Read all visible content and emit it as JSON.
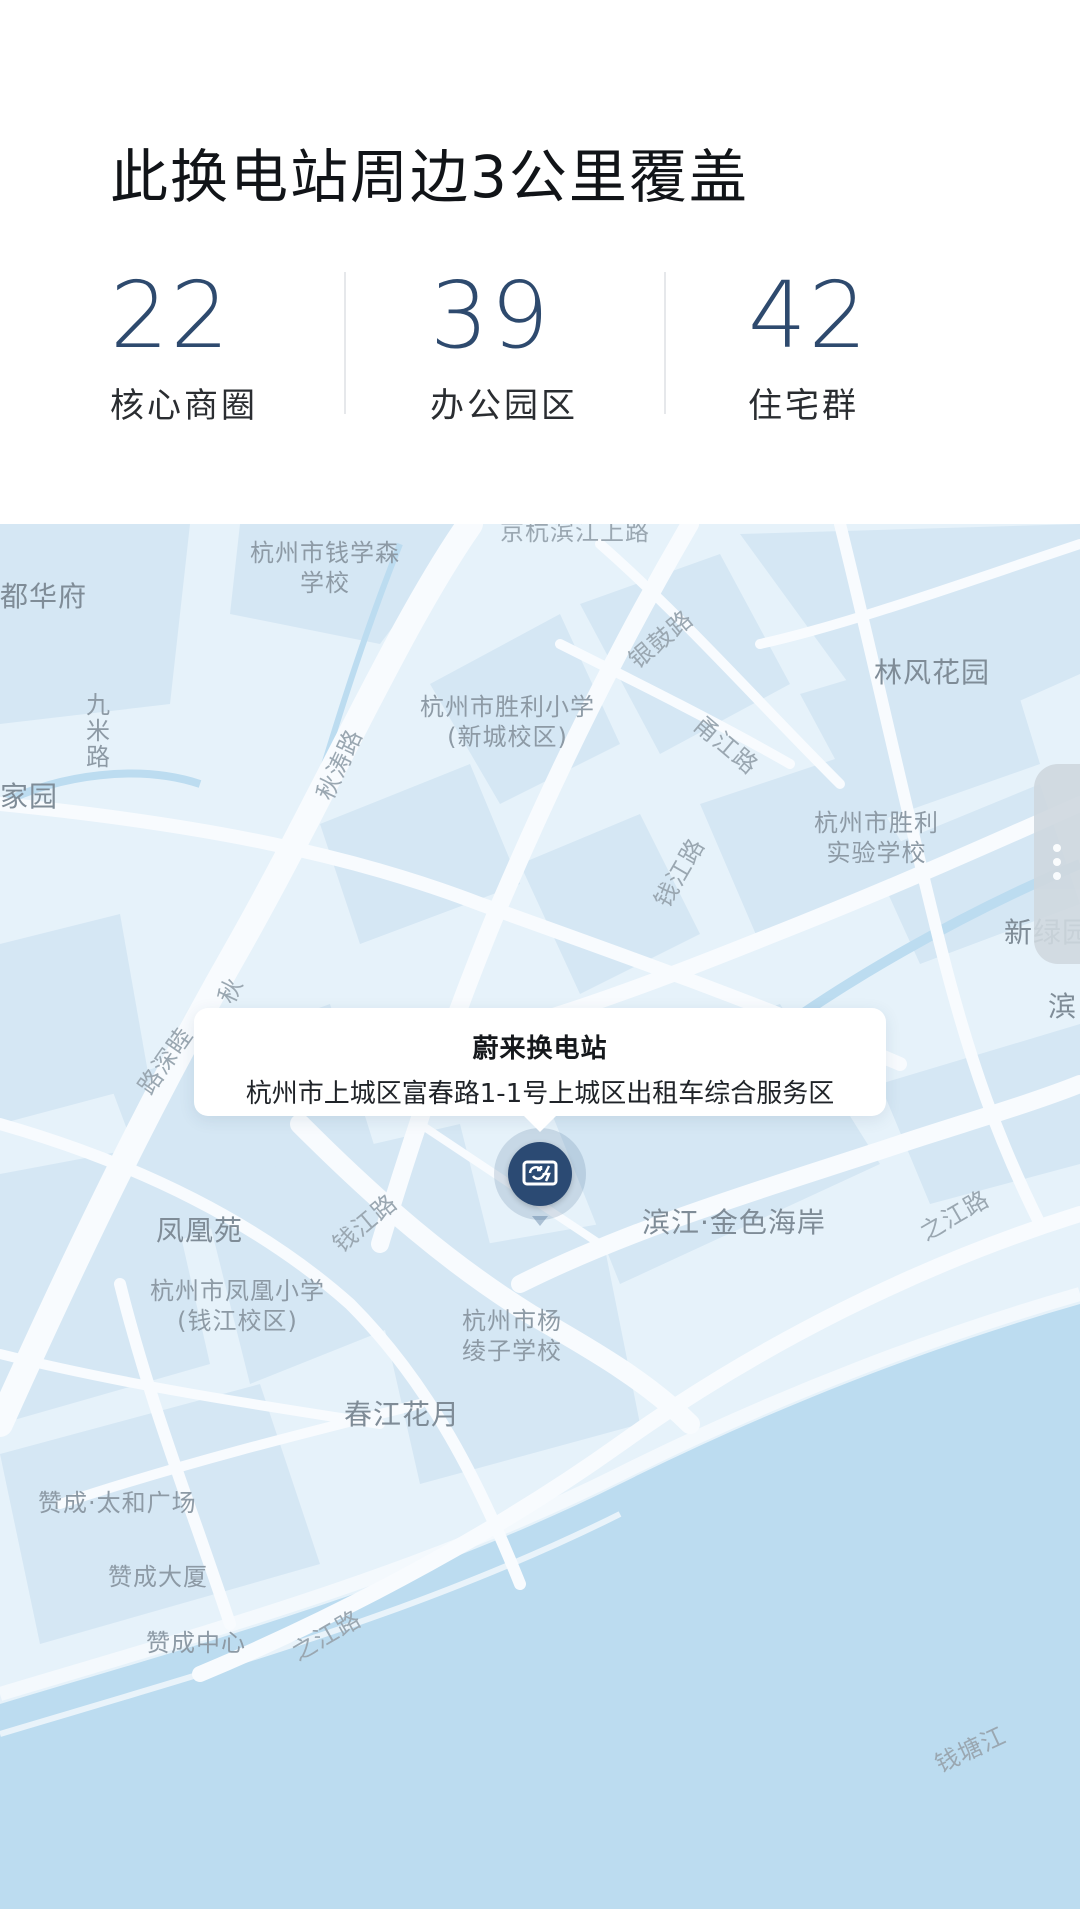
{
  "header": {
    "title": "此换电站周边3公里覆盖",
    "stats": [
      {
        "value": "22",
        "label": "核心商圈"
      },
      {
        "value": "39",
        "label": "办公园区"
      },
      {
        "value": "42",
        "label": "住宅群"
      }
    ]
  },
  "map": {
    "labels": {
      "qianxuesen": "杭州市钱学森\n学校",
      "duhuafu": "都华府",
      "jiamiroad": "九\n米\n路",
      "jiayuan": "家园",
      "shengli_xincheng": "杭州市胜利小学\n(新城校区)",
      "linfeng": "林风花园",
      "shengli_shiyan": "杭州市胜利\n实验学校",
      "xinlv": "新绿园",
      "bin": "滨",
      "fenghuangyuan": "凤凰苑",
      "fenghuang_school": "杭州市凤凰小学\n(钱江校区)",
      "yanglingzi": "杭州市杨\n绫子学校",
      "chunjiang": "春江花月",
      "binjiang_gold": "滨江·金色海岸",
      "zancheng_taihe": "赞成·太和广场",
      "zancheng_dasha": "赞成大厦",
      "zancheng_center": "赞成中心"
    },
    "roads": {
      "yingu": "银鼓路",
      "fujiang": "甬江路",
      "qiantang_road": "钱江路",
      "qiutao": "秋涛路",
      "qiu": "秋",
      "qiushi": "路深睦",
      "qianjiang_lower": "钱江路",
      "zhijiang_right": "之江路",
      "zhijiang_left": "之江路",
      "qiantangjiang": "钱塘江",
      "top_cut": "京杭滨江上路"
    },
    "station": {
      "name": "蔚来换电站",
      "address": "杭州市上城区富春路1-1号上城区出租车综合服务区"
    },
    "colors": {
      "land": "#e6f2fa",
      "block": "#d6e8f5",
      "road": "#f7fbfe",
      "water": "#bcdcf0",
      "marker": "#2b4a73"
    }
  }
}
